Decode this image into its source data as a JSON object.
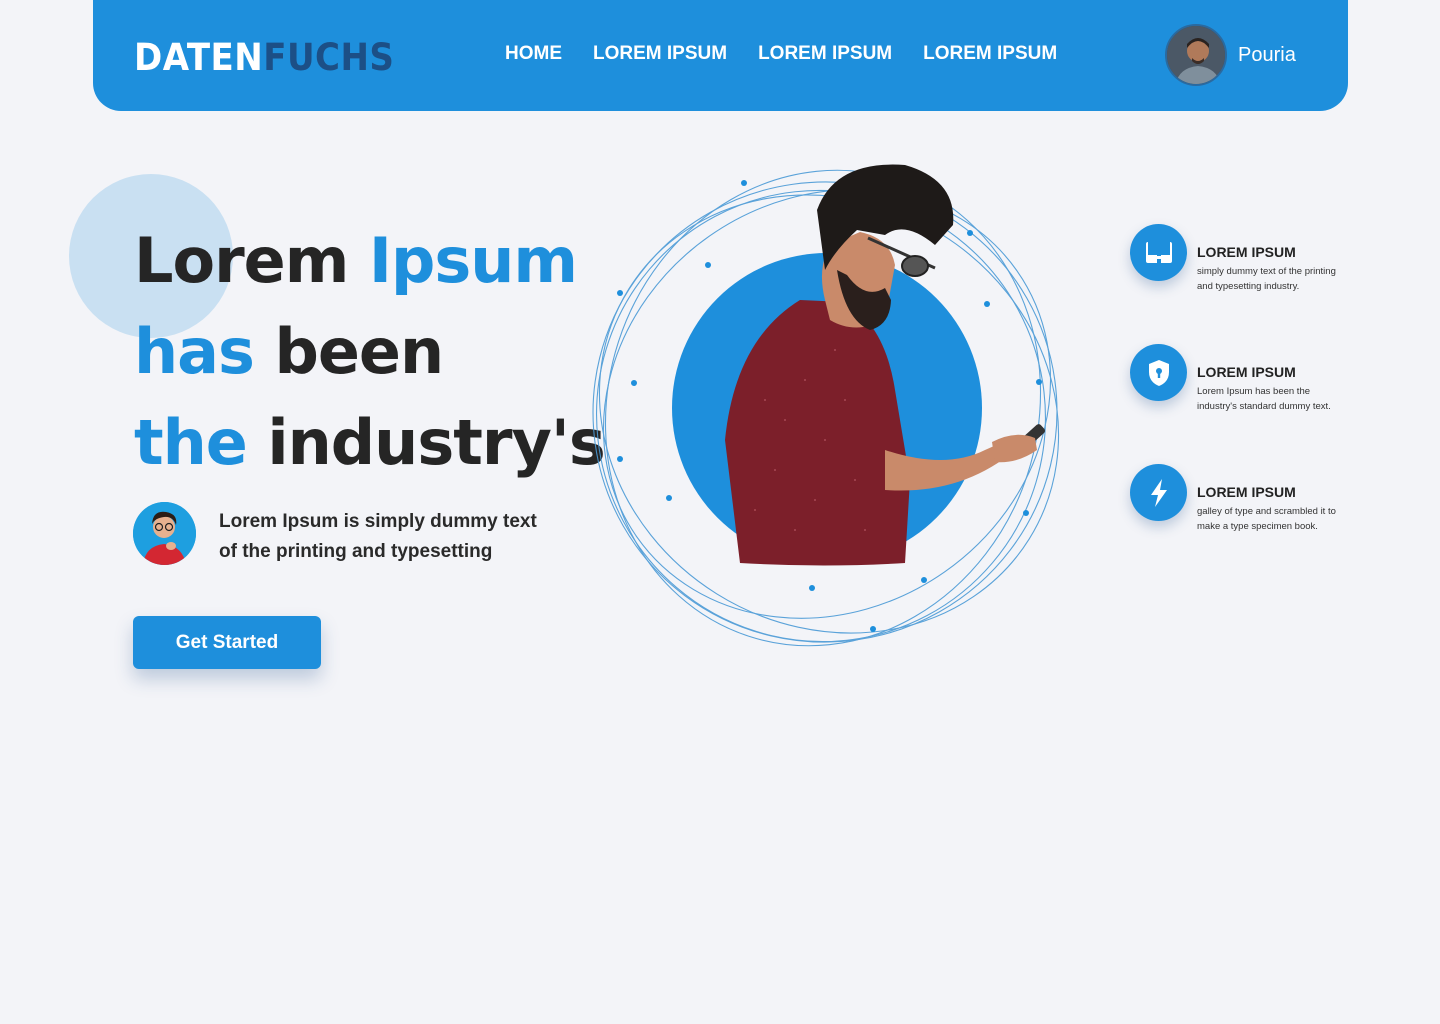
{
  "brand": {
    "part1": "DATEN",
    "part2": "FUCHS"
  },
  "nav": [
    {
      "label": "HOME"
    },
    {
      "label": "LOREM IPSUM"
    },
    {
      "label": "LOREM IPSUM"
    },
    {
      "label": "LOREM IPSUM"
    }
  ],
  "user": {
    "name": "Pouria"
  },
  "hero": {
    "line1_a": "Lorem ",
    "line1_b": "Ipsum",
    "line2_a": "has",
    "line2_b": " been",
    "line3_a": "the",
    "line3_b": " industry's",
    "subtext": "Lorem Ipsum is simply dummy text of the printing and typesetting",
    "cta_label": "Get Started"
  },
  "features": [
    {
      "icon": "glasses-icon",
      "title": "LOREM IPSUM",
      "desc": "simply dummy text of the printing and typesetting industry."
    },
    {
      "icon": "shield-lock-icon",
      "title": "LOREM IPSUM",
      "desc": "Lorem Ipsum has been the industry's standard dummy text."
    },
    {
      "icon": "lightning-icon",
      "title": "LOREM IPSUM",
      "desc": "galley of type and scrambled it to make a type specimen book."
    }
  ],
  "colors": {
    "accent": "#1e8fdc",
    "dark_accent": "#1c4f86",
    "background": "#f3f4f8",
    "light_circle": "#c9e0f2"
  }
}
